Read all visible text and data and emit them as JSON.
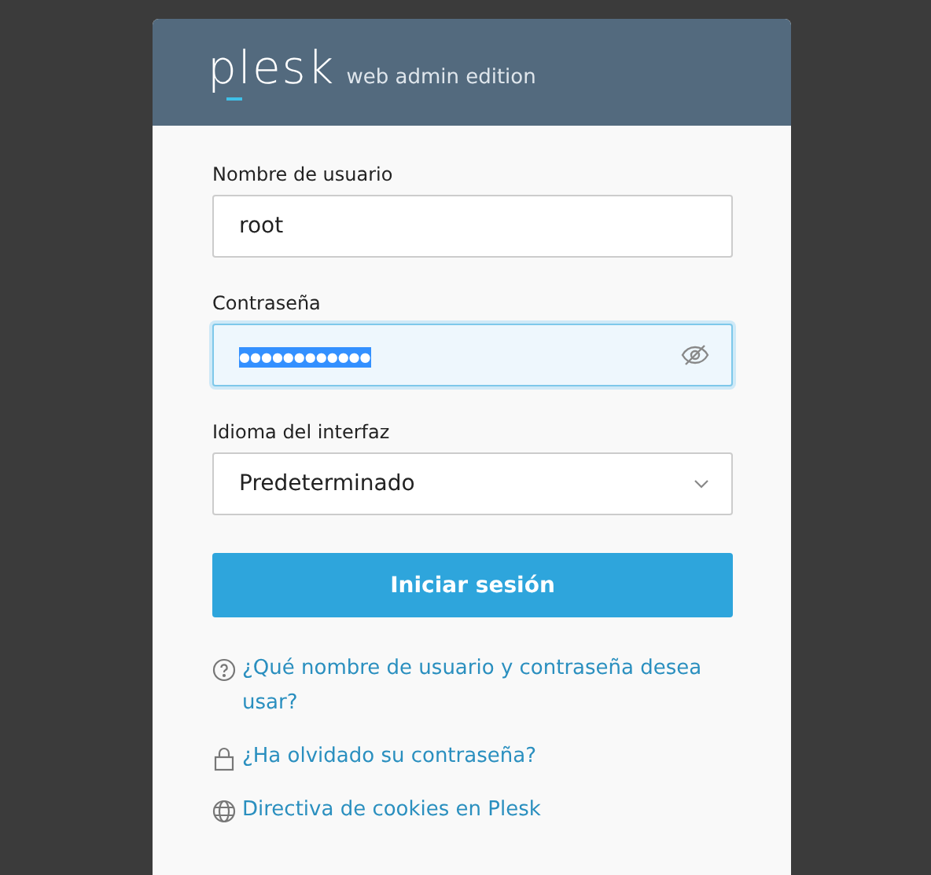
{
  "header": {
    "logo": "plesk",
    "edition": "web admin edition"
  },
  "fields": [
    {
      "kind": "text",
      "label": "Nombre de usuario",
      "value": "root",
      "focused": false
    },
    {
      "kind": "password",
      "label": "Contraseña",
      "value": "●●●●●●●●●●●●",
      "focused": true,
      "selected_text": true
    },
    {
      "kind": "select",
      "label": "Idioma del interfaz",
      "value": "Predeterminado",
      "focused": false
    }
  ],
  "submit": "Iniciar sesión",
  "links": [
    {
      "kind": "help",
      "text": "¿Qué nombre de usuario y contraseña desea usar?"
    },
    {
      "kind": "lock",
      "text": "¿Ha olvidado su contraseña?"
    },
    {
      "kind": "globe",
      "text": "Directiva de cookies en Plesk"
    }
  ]
}
